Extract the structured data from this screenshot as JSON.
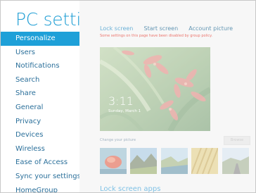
{
  "nav": {
    "title": "PC settings",
    "items": [
      {
        "label": "Personalize",
        "selected": true
      },
      {
        "label": "Users"
      },
      {
        "label": "Notifications"
      },
      {
        "label": "Search"
      },
      {
        "label": "Share"
      },
      {
        "label": "General"
      },
      {
        "label": "Privacy"
      },
      {
        "label": "Devices"
      },
      {
        "label": "Wireless"
      },
      {
        "label": "Ease of Access"
      },
      {
        "label": "Sync your settings"
      },
      {
        "label": "HomeGroup"
      }
    ]
  },
  "content": {
    "tabs": [
      {
        "label": "Lock screen",
        "active": true
      },
      {
        "label": "Start screen"
      },
      {
        "label": "Account picture"
      }
    ],
    "policy_notice": "Some settings on this page have been disabled by group policy.",
    "preview": {
      "time": "3:11",
      "date": "Sunday, March 1"
    },
    "change_picture_label": "Change your picture",
    "browse_label": "Browse",
    "thumbnails": [
      "red-flower",
      "mountain-valley",
      "coast-cliffs",
      "wheat-field",
      "road-landscape"
    ],
    "section_heading": "Lock screen apps"
  },
  "colors": {
    "accent": "#1ea0d8",
    "title": "#1f9ed4",
    "policy_text": "#e0281c",
    "content_bg": "#f3f3f3"
  }
}
